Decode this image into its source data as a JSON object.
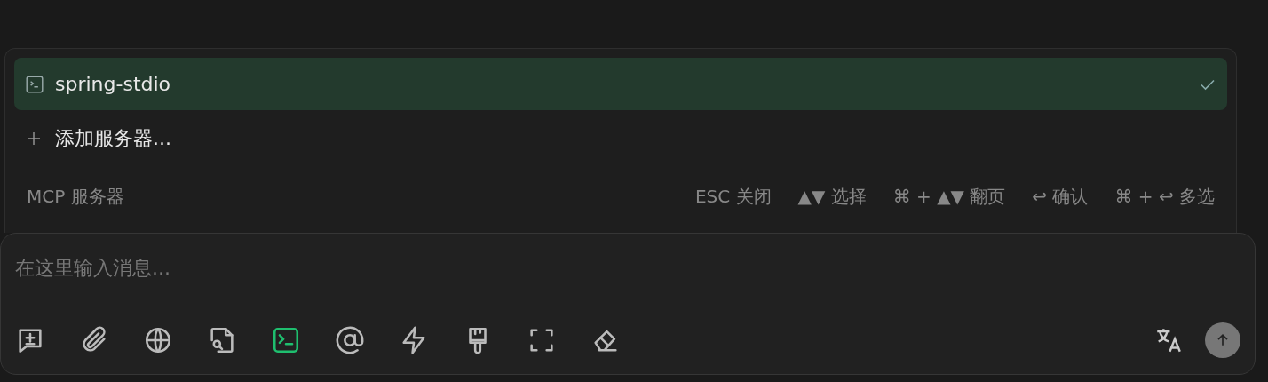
{
  "servers": [
    {
      "name": "spring-stdio",
      "selected": true
    }
  ],
  "add_server": {
    "label": "添加服务器..."
  },
  "footer": {
    "title": "MCP 服务器",
    "hints": [
      "ESC 关闭",
      "▲▼ 选择",
      "⌘ + ▲▼ 翻页",
      "↩ 确认",
      "⌘ + ↩ 多选"
    ]
  },
  "composer": {
    "placeholder": "在这里输入消息..."
  },
  "tools": [
    {
      "kind": "new-chat",
      "active": false
    },
    {
      "kind": "attach",
      "active": false
    },
    {
      "kind": "web",
      "active": false
    },
    {
      "kind": "file-search",
      "active": false
    },
    {
      "kind": "terminal",
      "active": true
    },
    {
      "kind": "mention",
      "active": false
    },
    {
      "kind": "flash",
      "active": false
    },
    {
      "kind": "brush",
      "active": false
    },
    {
      "kind": "fullscreen",
      "active": false
    },
    {
      "kind": "eraser",
      "active": false
    }
  ]
}
